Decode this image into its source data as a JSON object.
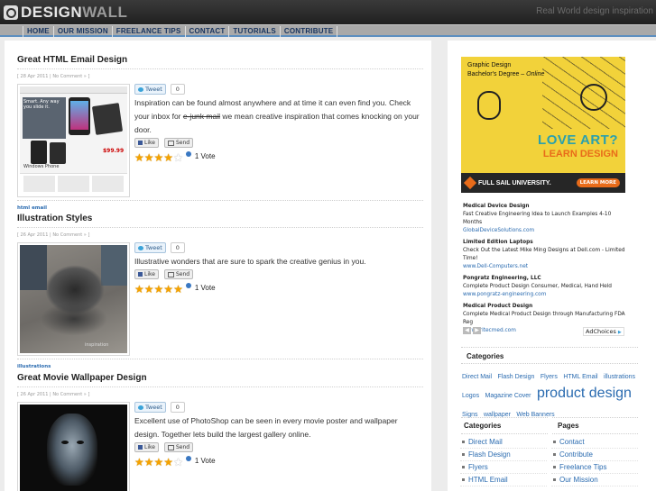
{
  "header": {
    "logo_design": "DESIGN",
    "logo_wall": "WALL",
    "tagline": "Real World design inspiration"
  },
  "nav": {
    "items": [
      "HOME",
      "OUR MISSION",
      "FREELANCE TIPS",
      "CONTACT",
      "TUTORIALS",
      "CONTRIBUTE"
    ]
  },
  "posts": [
    {
      "title": "Great HTML Email Design",
      "meta": "[ 28 Apr 2011 | No Comment » ]",
      "tweet_label": "Tweet",
      "tweet_count": "0",
      "excerpt_before": "Inspiration can be found almost anywhere and at time it can even find you. Check your inbox for ",
      "excerpt_strike": "e-junk mail",
      "excerpt_after": " we mean creative inspiration that comes knocking on your door.",
      "like_label": "Like",
      "send_label": "Send",
      "rating": 4,
      "votes": "1 Vote",
      "tag": "html email",
      "thumb_text": "Smart. Any way you slide it.",
      "thumb_price": "$99.99",
      "thumb_brand": "Windows Phone"
    },
    {
      "title": "Illustration Styles",
      "meta": "[ 26 Apr 2011 | No Comment » ]",
      "tweet_label": "Tweet",
      "tweet_count": "0",
      "excerpt_before": "Illustrative wonders that are sure to spark the creative genius in you.",
      "excerpt_strike": "",
      "excerpt_after": "",
      "like_label": "Like",
      "send_label": "Send",
      "rating": 5,
      "votes": "1 Vote",
      "tag": "illustrations"
    },
    {
      "title": "Great Movie Wallpaper Design",
      "meta": "[ 26 Apr 2011 | No Comment » ]",
      "tweet_label": "Tweet",
      "tweet_count": "0",
      "excerpt_before": "Excellent use of PhotoShop can be seen in every movie poster and wallpaper design. Together lets build the largest gallery online.",
      "excerpt_strike": "",
      "excerpt_after": "",
      "like_label": "Like",
      "send_label": "Send",
      "rating": 4,
      "votes": "1 Vote"
    }
  ],
  "sidebar": {
    "banner": {
      "line1": "Graphic Design",
      "line2_a": "Bachelor's Degree – ",
      "line2_b": "Online",
      "big1": "LOVE ART?",
      "big2": "LEARN DESIGN",
      "footer_logo": "FULL SAIL UNIVERSITY.",
      "learn_more": "LEARN MORE"
    },
    "text_ads": [
      {
        "title": "Medical Device Design",
        "body": "Fast Creative Engineering Idea to Launch Examples 4-10 Months",
        "url": "GlobalDeviceSolutions.com"
      },
      {
        "title": "Limited Edition Laptops",
        "body": "Check Out the Latest Mike Ming Designs at Dell.com - Limited Time!",
        "url": "www.Dell-Computers.net"
      },
      {
        "title": "Pongratz Engineering, LLC",
        "body": "Complete Product Design Consumer, Medical, Hand Held",
        "url": "www.pongratz-engineering.com"
      },
      {
        "title": "Medical Product Design",
        "body": "Complete Medical Product Design through Manufacturing FDA Reg",
        "url": "www.critecmed.com"
      }
    ],
    "adchoices": "AdChoices",
    "categories_heading": "Categories",
    "tag_cloud": [
      {
        "text": "Direct Mail",
        "size": 7
      },
      {
        "text": "Flash Design",
        "size": 7
      },
      {
        "text": "Flyers",
        "size": 7
      },
      {
        "text": "HTML Email",
        "size": 7
      },
      {
        "text": "illustrations",
        "size": 7
      },
      {
        "text": "Logos",
        "size": 7
      },
      {
        "text": "Magazine Cover",
        "size": 7
      },
      {
        "text": "product design",
        "size": 16
      },
      {
        "text": "Signs",
        "size": 7
      },
      {
        "text": "wallpaper",
        "size": 7
      },
      {
        "text": "Web Banners",
        "size": 7
      }
    ],
    "categories_list_heading": "Categories",
    "categories_list": [
      "Direct Mail",
      "Flash Design",
      "Flyers",
      "HTML Email"
    ],
    "pages_heading": "Pages",
    "pages_list": [
      "Contact",
      "Contribute",
      "Freelance Tips",
      "Our Mission"
    ]
  }
}
